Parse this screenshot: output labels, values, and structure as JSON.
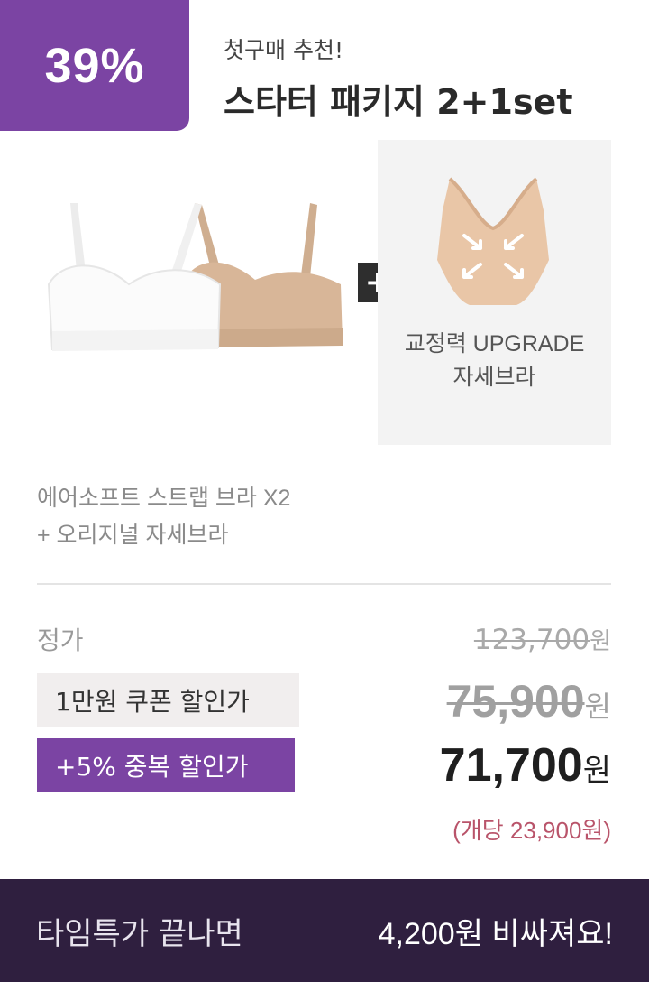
{
  "badge": {
    "discount": "39%"
  },
  "header": {
    "subtitle": "첫구매 추천!",
    "title": "스타터 패키지 2+1set"
  },
  "product": {
    "plus_symbol": "+",
    "upgrade_line1": "교정력 UPGRADE",
    "upgrade_line2": "자세브라",
    "desc_line1": "에어소프트 스트랩 브라 X2",
    "desc_line2": "+ 오리지널 자세브라",
    "bra_colors": {
      "white": "#fbfbfb",
      "beige": "#d8b698",
      "upgrade": "#e9c6a7"
    }
  },
  "pricing": {
    "regular_label": "정가",
    "regular_price": "123,700",
    "coupon_label": "1만원 쿠폰 할인가",
    "coupon_price": "75,900",
    "extra_label": "+5% 중복 할인가",
    "final_price": "71,700",
    "currency": "원",
    "per_item": "(개당 23,900원)"
  },
  "bottom_bar": {
    "left_text": "타임특가 끝나면",
    "right_text": "4,200원 비싸져요!"
  },
  "colors": {
    "brand_purple": "#7b44a3",
    "dark_bar": "#2f1f3f",
    "accent_pink": "#b9546a"
  }
}
